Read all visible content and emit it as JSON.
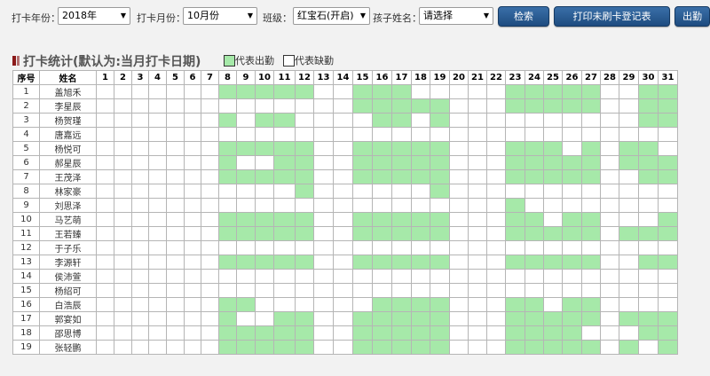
{
  "toolbar": {
    "year_label": "打卡年份：",
    "year_value": "2018年",
    "month_label": "打卡月份：",
    "month_value": "10月份",
    "class_label": "班级：",
    "class_value": "红宝石(开启)",
    "child_label": "孩子姓名：",
    "child_value": "请选择",
    "search_button": "检索",
    "print_button": "打印未刷卡登记表",
    "export_button": "出勤"
  },
  "section": {
    "title": "打卡统计(默认为:当月打卡日期)",
    "legend_present": "代表出勤",
    "legend_absent": "代表缺勤"
  },
  "colors": {
    "present": "#a6e9a9",
    "absent": "#ffffff",
    "button": "#2a5a92",
    "section_bar": "#8b1a1a"
  },
  "table": {
    "col_index": "序号",
    "col_name": "姓名",
    "days": [
      "1",
      "2",
      "3",
      "4",
      "5",
      "6",
      "7",
      "8",
      "9",
      "10",
      "11",
      "12",
      "13",
      "14",
      "15",
      "16",
      "17",
      "18",
      "19",
      "20",
      "21",
      "22",
      "23",
      "24",
      "25",
      "26",
      "27",
      "28",
      "29",
      "30",
      "31"
    ],
    "rows": [
      {
        "no": "1",
        "name": "盖旭禾",
        "present": "0000000111110011100000111110011"
      },
      {
        "no": "2",
        "name": "李星辰",
        "present": "0000000000000011111000111110011"
      },
      {
        "no": "3",
        "name": "杨贺瑾",
        "present": "0000000101100001101000000000011"
      },
      {
        "no": "4",
        "name": "唐嘉远",
        "present": "0000000000000000000000000000000"
      },
      {
        "no": "5",
        "name": "杨悦可",
        "present": "0000000111110011111000111010110"
      },
      {
        "no": "6",
        "name": "郝星辰",
        "present": "0000000100110011111000111110111"
      },
      {
        "no": "7",
        "name": "王茂泽",
        "present": "0000000111110011111000111110011"
      },
      {
        "no": "8",
        "name": "林家豪",
        "present": "0000000000010000001000000000000"
      },
      {
        "no": "9",
        "name": "刘思泽",
        "present": "0000000000000000000000100000000"
      },
      {
        "no": "10",
        "name": "马艺萌",
        "present": "0000000111110011111000110110001"
      },
      {
        "no": "11",
        "name": "王若臻",
        "present": "0000000111110011111000111110111"
      },
      {
        "no": "12",
        "name": "于子乐",
        "present": "0000000000000000000000000000000"
      },
      {
        "no": "13",
        "name": "李源轩",
        "present": "0000000111110011111000111110011"
      },
      {
        "no": "14",
        "name": "侯沛萱",
        "present": "0000000000000000000000000000000"
      },
      {
        "no": "15",
        "name": "杨绍可",
        "present": "0000000000000000000000000000000"
      },
      {
        "no": "16",
        "name": "白浩辰",
        "present": "0000000110000001111000110110000"
      },
      {
        "no": "17",
        "name": "郭宴如",
        "present": "0000000100110011111000111110111"
      },
      {
        "no": "18",
        "name": "邵思博",
        "present": "0000000111110011111000111100011"
      },
      {
        "no": "19",
        "name": "张轻鹏",
        "present": "0000000111110011111000111110101"
      }
    ]
  }
}
